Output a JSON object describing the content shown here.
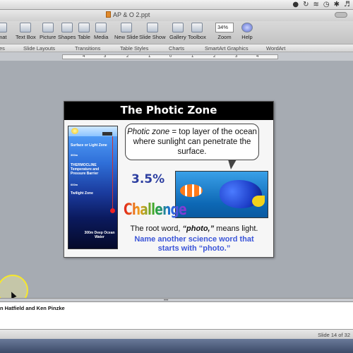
{
  "window": {
    "title": "AP & O 2.ppt"
  },
  "toolbar": {
    "items": [
      {
        "label": "rmat"
      },
      {
        "label": "Text Box"
      },
      {
        "label": "Picture"
      },
      {
        "label": "Shapes"
      },
      {
        "label": "Table"
      },
      {
        "label": "Media"
      },
      {
        "label": "New Slide"
      },
      {
        "label": "Slide Show"
      },
      {
        "label": "Gallery"
      },
      {
        "label": "Toolbox"
      },
      {
        "label": "Zoom"
      },
      {
        "label": "Help"
      }
    ],
    "zoom_value": "34%"
  },
  "ribbon": {
    "groups": [
      "es",
      "Slide Layouts",
      "Transitions",
      "Table Styles",
      "Charts",
      "SmartArt Graphics",
      "WordArt"
    ]
  },
  "ruler": {
    "ticks": [
      "4",
      "3",
      "2",
      "1",
      "0",
      "1",
      "2",
      "3",
      "4"
    ]
  },
  "slide": {
    "title": "The Photic Zone",
    "bubble_term": "Photic zone",
    "bubble_rest": " = top layer of the ocean where sunlight can penetrate the surface.",
    "percent": "3.5%",
    "challenge": "Challenge",
    "caption_prefix": "The root word, ",
    "caption_term": "“photo,”",
    "caption_suffix": " means light.",
    "caption2": "Name another science word that starts with “photo.”",
    "ocean_labels": [
      "Surface or Light Zone",
      "300m",
      "THERMOCLINE Temperature and Pressure Barrier",
      "600m",
      "Twilight Zone",
      "300m Deep Ocean Water"
    ]
  },
  "notes": {
    "text": "n Hatfield and Ken Pinzke"
  },
  "status": {
    "slide_indicator": "Slide 14 of 32"
  },
  "colors": {
    "slide_title_bg": "#000000",
    "caption2": "#3b55d8",
    "percent": "#2c3ea0",
    "cursor_highlight": "#f7e82a"
  }
}
